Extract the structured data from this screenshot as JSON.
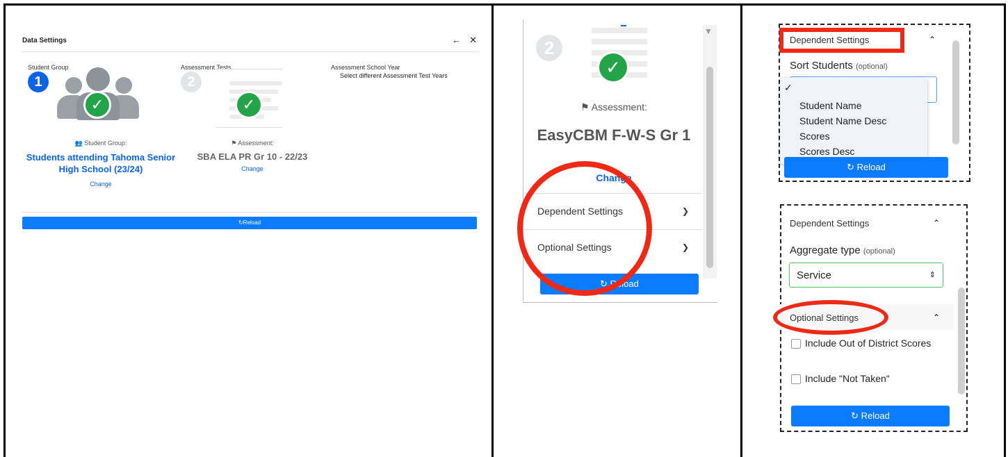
{
  "panel1": {
    "title": "Data Settings",
    "col_student_group": "Student Group",
    "col_assessment_tests": "Assessment Tests",
    "col_school_year": "Assessment School Year",
    "select_years_link": "Select different Assessment Test Years",
    "step1": "1",
    "step2": "2",
    "student_group_meta": "Student Group:",
    "student_group_name": "Students attending Tahoma Senior High School (23/24)",
    "student_group_change": "Change",
    "assessment_meta": "Assessment:",
    "assessment_name": "SBA ELA PR Gr 10 - 22/23",
    "assessment_change": "Change",
    "reload": "Reload"
  },
  "panel2": {
    "step": "2",
    "assessment_meta": "Assessment:",
    "assessment_name": "EasyCBM F-W-S Gr 1",
    "change": "Change",
    "dependent_settings": "Dependent Settings",
    "optional_settings": "Optional Settings",
    "reload": "Reload"
  },
  "panel3_top": {
    "dependent_settings": "Dependent Settings",
    "sort_students_label": "Sort Students",
    "optional_tag": "(optional)",
    "options": [
      "Student Name",
      "Student Name Desc",
      "Scores",
      "Scores Desc"
    ],
    "reload": "Reload"
  },
  "panel3_bottom": {
    "dependent_settings": "Dependent Settings",
    "aggregate_label": "Aggregate type",
    "optional_tag": "(optional)",
    "aggregate_value": "Service",
    "optional_settings": "Optional Settings",
    "checkbox1": "Include Out of District Scores",
    "checkbox2": "Include \"Not Taken\"",
    "reload": "Reload"
  },
  "colors": {
    "primary": "#0b7bff",
    "link": "#0b63e5",
    "success": "#23a449",
    "annotation": "#ee2a16"
  }
}
